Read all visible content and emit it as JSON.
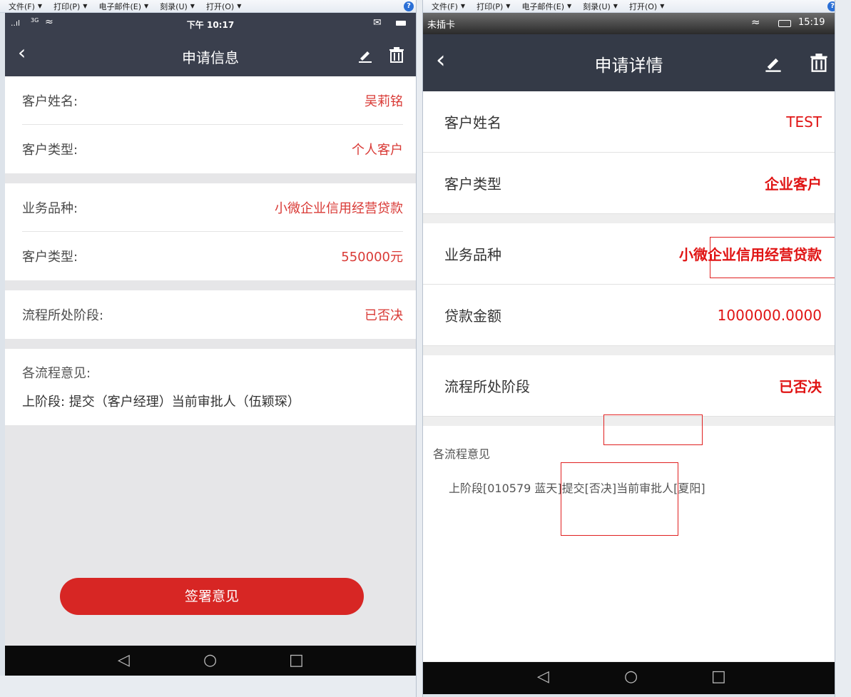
{
  "menubar": {
    "items": [
      "文件(F)",
      "打印(P)",
      "电子邮件(E)",
      "刻录(U)",
      "打开(O)"
    ],
    "help": "?"
  },
  "left": {
    "status": {
      "signal": "..ıl",
      "network": "3G",
      "wifi": "≈",
      "time": "下午 10:17"
    },
    "nav": {
      "title": "申请信息"
    },
    "rows": [
      {
        "label": "客户姓名:",
        "value": "吴莉铭"
      },
      {
        "label": "客户类型:",
        "value": "个人客户"
      },
      {
        "label": "业务品种:",
        "value": "小微企业信用经营贷款"
      },
      {
        "label": "客户类型:",
        "value": "550000元"
      },
      {
        "label": "流程所处阶段:",
        "value": "已否决"
      }
    ],
    "opinions": {
      "heading": "各流程意见:",
      "text": "上阶段: 提交（客户经理）当前审批人（伍颖琛）"
    },
    "sign_button": "签署意见"
  },
  "right": {
    "status": {
      "carrier": "未插卡",
      "time": "15:19"
    },
    "nav": {
      "title": "申请详情"
    },
    "rows": [
      {
        "label": "客户姓名",
        "value": "TEST"
      },
      {
        "label": "客户类型",
        "value": "企业客户"
      },
      {
        "label": "业务品种",
        "value": "小微企业信用经营贷款"
      },
      {
        "label": "贷款金额",
        "value": "1000000.0000"
      },
      {
        "label": "流程所处阶段",
        "value": "已否决"
      }
    ],
    "opinions": {
      "heading": "各流程意见",
      "text": "上阶段[010579 蓝天]提交[否决]当前审批人[夏阳]"
    }
  },
  "colors": {
    "accent_red": "#d72624",
    "nav_bg": "#3a3f4d"
  }
}
